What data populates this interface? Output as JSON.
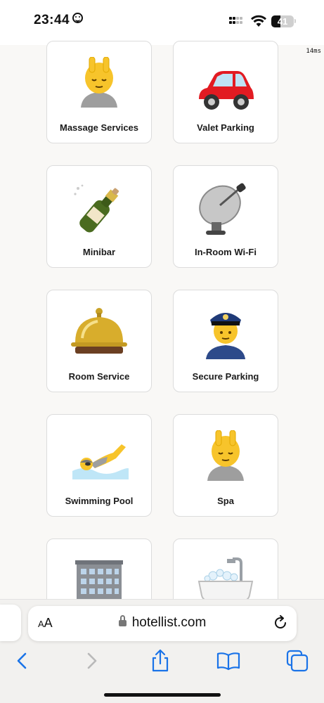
{
  "status_bar": {
    "time": "23:44",
    "battery_level": 41,
    "battery_label": "41"
  },
  "timing_overlay": "14ms",
  "amenities": [
    {
      "label": "Massage Services",
      "icon": "massage-icon"
    },
    {
      "label": "Valet Parking",
      "icon": "car-icon"
    },
    {
      "label": "Minibar",
      "icon": "champagne-icon"
    },
    {
      "label": "In-Room Wi-Fi",
      "icon": "satellite-dish-icon"
    },
    {
      "label": "Room Service",
      "icon": "bellhop-bell-icon"
    },
    {
      "label": "Secure Parking",
      "icon": "police-officer-icon"
    },
    {
      "label": "Swimming Pool",
      "icon": "swimmer-icon"
    },
    {
      "label": "Spa",
      "icon": "massage-icon"
    },
    {
      "label": "",
      "icon": "office-building-icon"
    },
    {
      "label": "",
      "icon": "bathtub-icon"
    }
  ],
  "browser": {
    "text_size_button": "AA",
    "url": "hotellist.com"
  },
  "colors": {
    "accent": "#1a73e8",
    "page_background": "#f9f8f6"
  }
}
